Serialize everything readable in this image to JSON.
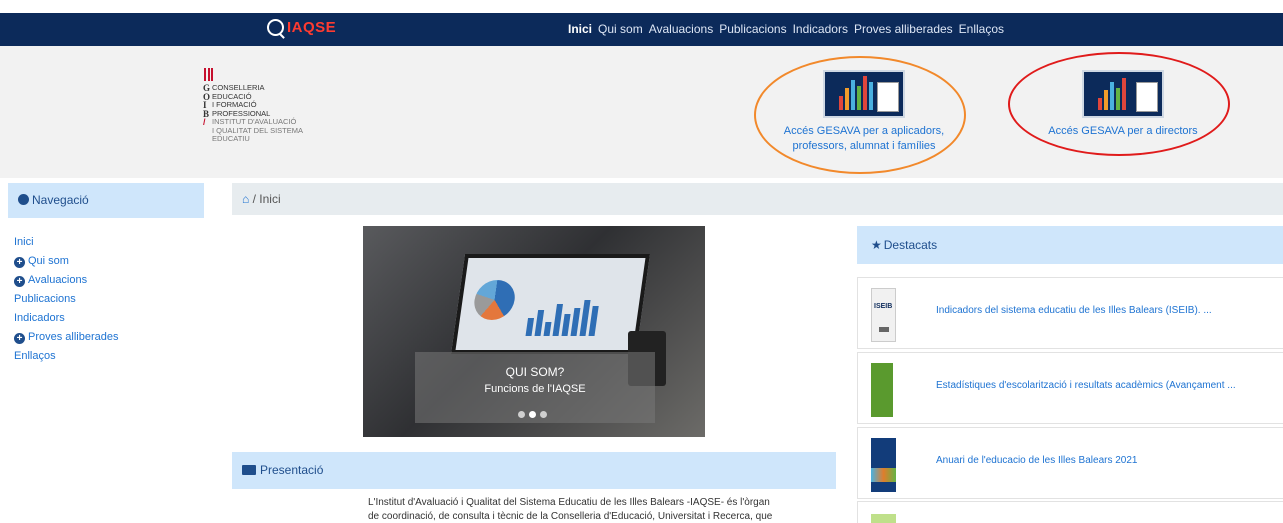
{
  "site": {
    "logo_text": "IAQSE"
  },
  "topnav": {
    "items": [
      "Inici",
      "Qui som",
      "Avaluacions",
      "Publicacions",
      "Indicadors",
      "Proves alliberades",
      "Enllaços"
    ],
    "active": "Inici"
  },
  "gov_logo": {
    "lines": [
      {
        "letter": "G",
        "text": "CONSELLERIA"
      },
      {
        "letter": "O",
        "text": "EDUCACIÓ"
      },
      {
        "letter": "I",
        "text": "I FORMACIÓ"
      },
      {
        "letter": "B",
        "text": "PROFESSIONAL"
      }
    ],
    "institut_lines": [
      "INSTITUT D'AVALUACIÓ",
      "I QUALITAT DEL SISTEMA",
      "EDUCATIU"
    ]
  },
  "gesava": {
    "aplicadors": {
      "line1": "Accés GESAVA per a aplicadors,",
      "line2": "professors, alumnat i famílies"
    },
    "directors": "Accés GESAVA per a directors"
  },
  "annotations": {
    "orange_ring_color": "#f2892b",
    "red_ring_color": "#e01b1b"
  },
  "sidebar": {
    "heading": "Navegació",
    "items": [
      {
        "label": "Inici",
        "expandable": false
      },
      {
        "label": "Qui som",
        "expandable": true
      },
      {
        "label": "Avaluacions",
        "expandable": true
      },
      {
        "label": "Publicacions",
        "expandable": false
      },
      {
        "label": "Indicadors",
        "expandable": false
      },
      {
        "label": "Proves alliberades",
        "expandable": true
      },
      {
        "label": "Enllaços",
        "expandable": false
      }
    ]
  },
  "breadcrumb": {
    "separator": "/",
    "current": "Inici"
  },
  "carousel": {
    "title": "QUI SOM?",
    "subtitle": "Funcions de l'IAQSE",
    "slides": 3,
    "active_slide": 2
  },
  "presentacio": {
    "heading": "Presentació",
    "text_line1": "L'Institut d'Avaluació i Qualitat del Sistema Educatiu de les Illes Balears -IAQSE- és l'òrgan",
    "text_line2": "de coordinació, de consulta i tècnic de la Conselleria d'Educació, Universitat i Recerca, que"
  },
  "destacats": {
    "heading": "Destacats",
    "items": [
      {
        "label": "Indicadors del sistema educatiu de les Illes Balears (ISEIB). ...",
        "thumb_text": "ISEIB"
      },
      {
        "label": "Estadístiques d'escolarització i resultats acadèmics (Avançament ...",
        "thumb_text": ""
      },
      {
        "label": "Anuari de l'educacio de les Illes Balears 2021",
        "thumb_text": "anuari"
      }
    ]
  },
  "colors": {
    "navbar": "#0c2a5a",
    "accent": "#1e73d2",
    "panel": "#cfe6fb",
    "logo_red": "#ff3b30"
  }
}
